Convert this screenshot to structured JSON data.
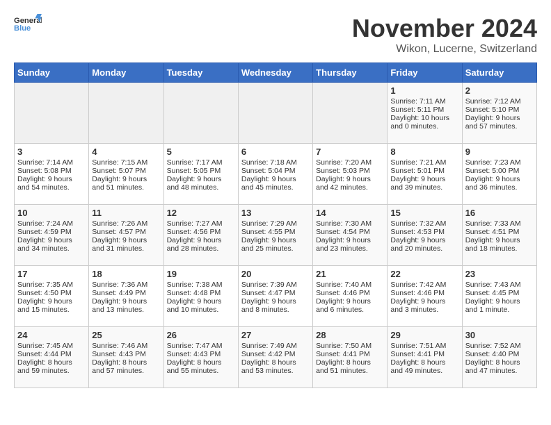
{
  "header": {
    "logo_general": "General",
    "logo_blue": "Blue",
    "month": "November 2024",
    "location": "Wikon, Lucerne, Switzerland"
  },
  "days_of_week": [
    "Sunday",
    "Monday",
    "Tuesday",
    "Wednesday",
    "Thursday",
    "Friday",
    "Saturday"
  ],
  "weeks": [
    [
      {
        "day": "",
        "content": ""
      },
      {
        "day": "",
        "content": ""
      },
      {
        "day": "",
        "content": ""
      },
      {
        "day": "",
        "content": ""
      },
      {
        "day": "",
        "content": ""
      },
      {
        "day": "1",
        "content": "Sunrise: 7:11 AM\nSunset: 5:11 PM\nDaylight: 10 hours and 0 minutes."
      },
      {
        "day": "2",
        "content": "Sunrise: 7:12 AM\nSunset: 5:10 PM\nDaylight: 9 hours and 57 minutes."
      }
    ],
    [
      {
        "day": "3",
        "content": "Sunrise: 7:14 AM\nSunset: 5:08 PM\nDaylight: 9 hours and 54 minutes."
      },
      {
        "day": "4",
        "content": "Sunrise: 7:15 AM\nSunset: 5:07 PM\nDaylight: 9 hours and 51 minutes."
      },
      {
        "day": "5",
        "content": "Sunrise: 7:17 AM\nSunset: 5:05 PM\nDaylight: 9 hours and 48 minutes."
      },
      {
        "day": "6",
        "content": "Sunrise: 7:18 AM\nSunset: 5:04 PM\nDaylight: 9 hours and 45 minutes."
      },
      {
        "day": "7",
        "content": "Sunrise: 7:20 AM\nSunset: 5:03 PM\nDaylight: 9 hours and 42 minutes."
      },
      {
        "day": "8",
        "content": "Sunrise: 7:21 AM\nSunset: 5:01 PM\nDaylight: 9 hours and 39 minutes."
      },
      {
        "day": "9",
        "content": "Sunrise: 7:23 AM\nSunset: 5:00 PM\nDaylight: 9 hours and 36 minutes."
      }
    ],
    [
      {
        "day": "10",
        "content": "Sunrise: 7:24 AM\nSunset: 4:59 PM\nDaylight: 9 hours and 34 minutes."
      },
      {
        "day": "11",
        "content": "Sunrise: 7:26 AM\nSunset: 4:57 PM\nDaylight: 9 hours and 31 minutes."
      },
      {
        "day": "12",
        "content": "Sunrise: 7:27 AM\nSunset: 4:56 PM\nDaylight: 9 hours and 28 minutes."
      },
      {
        "day": "13",
        "content": "Sunrise: 7:29 AM\nSunset: 4:55 PM\nDaylight: 9 hours and 25 minutes."
      },
      {
        "day": "14",
        "content": "Sunrise: 7:30 AM\nSunset: 4:54 PM\nDaylight: 9 hours and 23 minutes."
      },
      {
        "day": "15",
        "content": "Sunrise: 7:32 AM\nSunset: 4:53 PM\nDaylight: 9 hours and 20 minutes."
      },
      {
        "day": "16",
        "content": "Sunrise: 7:33 AM\nSunset: 4:51 PM\nDaylight: 9 hours and 18 minutes."
      }
    ],
    [
      {
        "day": "17",
        "content": "Sunrise: 7:35 AM\nSunset: 4:50 PM\nDaylight: 9 hours and 15 minutes."
      },
      {
        "day": "18",
        "content": "Sunrise: 7:36 AM\nSunset: 4:49 PM\nDaylight: 9 hours and 13 minutes."
      },
      {
        "day": "19",
        "content": "Sunrise: 7:38 AM\nSunset: 4:48 PM\nDaylight: 9 hours and 10 minutes."
      },
      {
        "day": "20",
        "content": "Sunrise: 7:39 AM\nSunset: 4:47 PM\nDaylight: 9 hours and 8 minutes."
      },
      {
        "day": "21",
        "content": "Sunrise: 7:40 AM\nSunset: 4:46 PM\nDaylight: 9 hours and 6 minutes."
      },
      {
        "day": "22",
        "content": "Sunrise: 7:42 AM\nSunset: 4:46 PM\nDaylight: 9 hours and 3 minutes."
      },
      {
        "day": "23",
        "content": "Sunrise: 7:43 AM\nSunset: 4:45 PM\nDaylight: 9 hours and 1 minute."
      }
    ],
    [
      {
        "day": "24",
        "content": "Sunrise: 7:45 AM\nSunset: 4:44 PM\nDaylight: 8 hours and 59 minutes."
      },
      {
        "day": "25",
        "content": "Sunrise: 7:46 AM\nSunset: 4:43 PM\nDaylight: 8 hours and 57 minutes."
      },
      {
        "day": "26",
        "content": "Sunrise: 7:47 AM\nSunset: 4:43 PM\nDaylight: 8 hours and 55 minutes."
      },
      {
        "day": "27",
        "content": "Sunrise: 7:49 AM\nSunset: 4:42 PM\nDaylight: 8 hours and 53 minutes."
      },
      {
        "day": "28",
        "content": "Sunrise: 7:50 AM\nSunset: 4:41 PM\nDaylight: 8 hours and 51 minutes."
      },
      {
        "day": "29",
        "content": "Sunrise: 7:51 AM\nSunset: 4:41 PM\nDaylight: 8 hours and 49 minutes."
      },
      {
        "day": "30",
        "content": "Sunrise: 7:52 AM\nSunset: 4:40 PM\nDaylight: 8 hours and 47 minutes."
      }
    ]
  ]
}
